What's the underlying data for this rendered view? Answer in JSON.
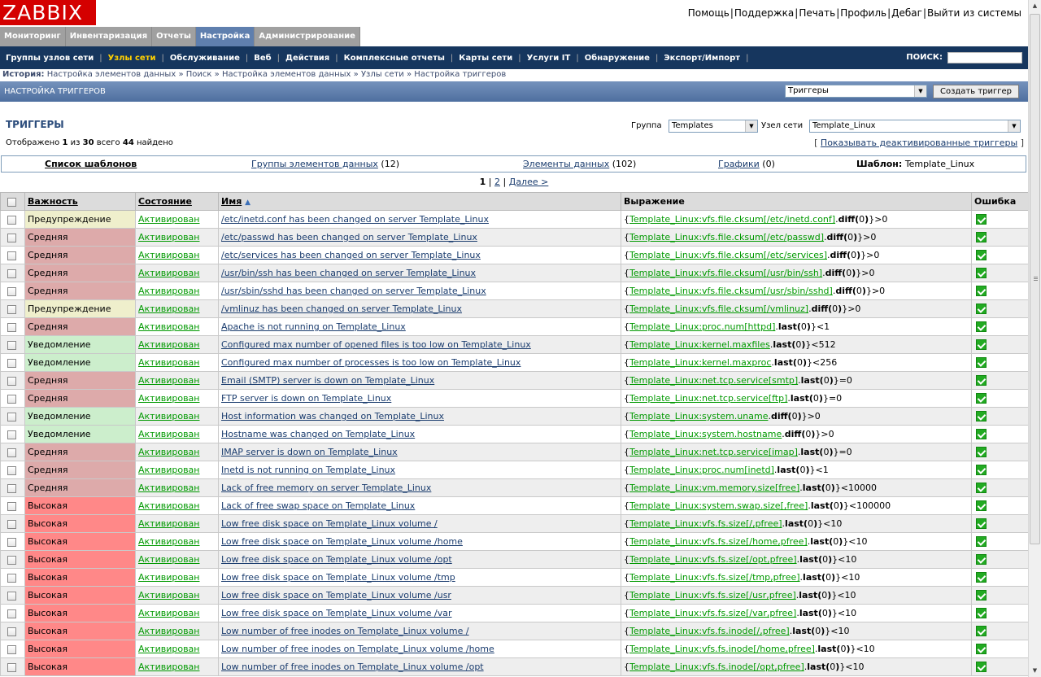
{
  "header": {
    "logo": "ZABBIX",
    "links": [
      "Помощь",
      "Поддержка",
      "Печать",
      "Профиль",
      "Дебаг",
      "Выйти из системы"
    ]
  },
  "main_menu": [
    "Мониторинг",
    "Инвентаризация",
    "Отчеты",
    "Настройка",
    "Администрирование"
  ],
  "main_menu_active": "Настройка",
  "sub_menu": [
    "Группы узлов сети",
    "Узлы сети",
    "Обслуживание",
    "Веб",
    "Действия",
    "Комплексные отчеты",
    "Карты сети",
    "Услуги IT",
    "Обнаружение",
    "Экспорт/Импорт"
  ],
  "sub_menu_active": "Узлы сети",
  "search_label": "ПОИСК:",
  "breadcrumb": {
    "label": "История:",
    "items": [
      "Настройка элементов данных",
      "Поиск",
      "Настройка элементов данных",
      "Узлы сети",
      "Настройка триггеров"
    ],
    "separator": "»"
  },
  "titlebar": {
    "title": "НАСТРОЙКА ТРИГГЕРОВ",
    "select_value": "Триггеры",
    "create_button": "Создать триггер"
  },
  "filter": {
    "title": "ТРИГГЕРЫ",
    "count_prefix": "Отображено",
    "count_from": "1",
    "count_of_label": "из",
    "count_to": "30",
    "count_total_label": "всего",
    "count_total": "44",
    "count_found_label": "найдено",
    "group_label": "Группа",
    "group_value": "Templates",
    "host_label": "Узел сети",
    "host_value": "Template_Linux",
    "show_disabled": "Показывать деактивированные триггеры"
  },
  "tabs": {
    "template_list": "Список шаблонов",
    "applications": "Группы элементов данных",
    "applications_count": "(12)",
    "items": "Элементы данных",
    "items_count": "(102)",
    "graphs": "Графики",
    "graphs_count": "(0)",
    "template_label": "Шаблон:",
    "template_value": "Template_Linux"
  },
  "pager": {
    "current": "1",
    "other": "2",
    "next": "Далее >"
  },
  "table": {
    "headers": {
      "severity": "Важность",
      "status": "Состояние",
      "name": "Имя",
      "expression": "Выражение",
      "error": "Ошибка"
    },
    "rows": [
      {
        "sev": "Предупреждение",
        "sevclass": "warn",
        "status": "Активирован",
        "name": "/etc/inetd.conf has been changed on server Template_Linux",
        "pre": "{",
        "key": "Template_Linux:vfs.file.cksum[/etc/inetd.conf]",
        "fn": "diff",
        "arg": "0",
        "post": "}>0"
      },
      {
        "sev": "Средняя",
        "sevclass": "avg",
        "status": "Активирован",
        "name": "/etc/passwd has been changed on server Template_Linux",
        "pre": "{",
        "key": "Template_Linux:vfs.file.cksum[/etc/passwd]",
        "fn": "diff",
        "arg": "0",
        "post": "}>0"
      },
      {
        "sev": "Средняя",
        "sevclass": "avg",
        "status": "Активирован",
        "name": "/etc/services has been changed on server Template_Linux",
        "pre": "{",
        "key": "Template_Linux:vfs.file.cksum[/etc/services]",
        "fn": "diff",
        "arg": "0",
        "post": "}>0"
      },
      {
        "sev": "Средняя",
        "sevclass": "avg",
        "status": "Активирован",
        "name": "/usr/bin/ssh has been changed on server Template_Linux",
        "pre": "{",
        "key": "Template_Linux:vfs.file.cksum[/usr/bin/ssh]",
        "fn": "diff",
        "arg": "0",
        "post": "}>0"
      },
      {
        "sev": "Средняя",
        "sevclass": "avg",
        "status": "Активирован",
        "name": "/usr/sbin/sshd has been changed on server Template_Linux",
        "pre": "{",
        "key": "Template_Linux:vfs.file.cksum[/usr/sbin/sshd]",
        "fn": "diff",
        "arg": "0",
        "post": "}>0"
      },
      {
        "sev": "Предупреждение",
        "sevclass": "warn",
        "status": "Активирован",
        "name": "/vmlinuz has been changed on server Template_Linux",
        "pre": "{",
        "key": "Template_Linux:vfs.file.cksum[/vmlinuz]",
        "fn": "diff",
        "arg": "0",
        "post": "}>0"
      },
      {
        "sev": "Средняя",
        "sevclass": "avg",
        "status": "Активирован",
        "name": "Apache is not running on Template_Linux",
        "pre": "{",
        "key": "Template_Linux:proc.num[httpd]",
        "fn": "last",
        "arg": "0",
        "post": "}<1"
      },
      {
        "sev": "Уведомление",
        "sevclass": "info",
        "status": "Активирован",
        "name": "Configured max number of opened files is too low on Template_Linux",
        "pre": "{",
        "key": "Template_Linux:kernel.maxfiles",
        "fn": "last",
        "arg": "0",
        "post": "}<512"
      },
      {
        "sev": "Уведомление",
        "sevclass": "info",
        "status": "Активирован",
        "name": "Configured max number of processes is too low on Template_Linux",
        "pre": "{",
        "key": "Template_Linux:kernel.maxproc",
        "fn": "last",
        "arg": "0",
        "post": "}<256"
      },
      {
        "sev": "Средняя",
        "sevclass": "avg",
        "status": "Активирован",
        "name": "Email (SMTP) server is down on Template_Linux",
        "pre": "{",
        "key": "Template_Linux:net.tcp.service[smtp]",
        "fn": "last",
        "arg": "0",
        "post": "}=0"
      },
      {
        "sev": "Средняя",
        "sevclass": "avg",
        "status": "Активирован",
        "name": "FTP server is down on Template_Linux",
        "pre": "{",
        "key": "Template_Linux:net.tcp.service[ftp]",
        "fn": "last",
        "arg": "0",
        "post": "}=0"
      },
      {
        "sev": "Уведомление",
        "sevclass": "info",
        "status": "Активирован",
        "name": "Host information was changed on Template_Linux",
        "pre": "{",
        "key": "Template_Linux:system.uname",
        "fn": "diff",
        "arg": "0",
        "post": "}>0"
      },
      {
        "sev": "Уведомление",
        "sevclass": "info",
        "status": "Активирован",
        "name": "Hostname was changed on Template_Linux",
        "pre": "{",
        "key": "Template_Linux:system.hostname",
        "fn": "diff",
        "arg": "0",
        "post": "}>0"
      },
      {
        "sev": "Средняя",
        "sevclass": "avg",
        "status": "Активирован",
        "name": "IMAP server is down on Template_Linux",
        "pre": "{",
        "key": "Template_Linux:net.tcp.service[imap]",
        "fn": "last",
        "arg": "0",
        "post": "}=0"
      },
      {
        "sev": "Средняя",
        "sevclass": "avg",
        "status": "Активирован",
        "name": "Inetd is not running on Template_Linux",
        "pre": "{",
        "key": "Template_Linux:proc.num[inetd]",
        "fn": "last",
        "arg": "0",
        "post": "}<1"
      },
      {
        "sev": "Средняя",
        "sevclass": "avg",
        "status": "Активирован",
        "name": "Lack of free memory on server Template_Linux",
        "pre": "{",
        "key": "Template_Linux:vm.memory.size[free]",
        "fn": "last",
        "arg": "0",
        "post": "}<10000"
      },
      {
        "sev": "Высокая",
        "sevclass": "high",
        "status": "Активирован",
        "name": "Lack of free swap space on Template_Linux",
        "pre": "{",
        "key": "Template_Linux:system.swap.size[,free]",
        "fn": "last",
        "arg": "0",
        "post": "}<100000"
      },
      {
        "sev": "Высокая",
        "sevclass": "high",
        "status": "Активирован",
        "name": "Low free disk space on Template_Linux volume /",
        "pre": "{",
        "key": "Template_Linux:vfs.fs.size[/,pfree]",
        "fn": "last",
        "arg": "0",
        "post": "}<10"
      },
      {
        "sev": "Высокая",
        "sevclass": "high",
        "status": "Активирован",
        "name": "Low free disk space on Template_Linux volume /home",
        "pre": "{",
        "key": "Template_Linux:vfs.fs.size[/home,pfree]",
        "fn": "last",
        "arg": "0",
        "post": "}<10"
      },
      {
        "sev": "Высокая",
        "sevclass": "high",
        "status": "Активирован",
        "name": "Low free disk space on Template_Linux volume /opt",
        "pre": "{",
        "key": "Template_Linux:vfs.fs.size[/opt,pfree]",
        "fn": "last",
        "arg": "0",
        "post": "}<10"
      },
      {
        "sev": "Высокая",
        "sevclass": "high",
        "status": "Активирован",
        "name": "Low free disk space on Template_Linux volume /tmp",
        "pre": "{",
        "key": "Template_Linux:vfs.fs.size[/tmp,pfree]",
        "fn": "last",
        "arg": "0",
        "post": "}<10"
      },
      {
        "sev": "Высокая",
        "sevclass": "high",
        "status": "Активирован",
        "name": "Low free disk space on Template_Linux volume /usr",
        "pre": "{",
        "key": "Template_Linux:vfs.fs.size[/usr,pfree]",
        "fn": "last",
        "arg": "0",
        "post": "}<10"
      },
      {
        "sev": "Высокая",
        "sevclass": "high",
        "status": "Активирован",
        "name": "Low free disk space on Template_Linux volume /var",
        "pre": "{",
        "key": "Template_Linux:vfs.fs.size[/var,pfree]",
        "fn": "last",
        "arg": "0",
        "post": "}<10"
      },
      {
        "sev": "Высокая",
        "sevclass": "high",
        "status": "Активирован",
        "name": "Low number of free inodes on Template_Linux volume /",
        "pre": "{",
        "key": "Template_Linux:vfs.fs.inode[/,pfree]",
        "fn": "last",
        "arg": "0",
        "post": "}<10"
      },
      {
        "sev": "Высокая",
        "sevclass": "high",
        "status": "Активирован",
        "name": "Low number of free inodes on Template_Linux volume /home",
        "pre": "{",
        "key": "Template_Linux:vfs.fs.inode[/home,pfree]",
        "fn": "last",
        "arg": "0",
        "post": "}<10"
      },
      {
        "sev": "Высокая",
        "sevclass": "high",
        "status": "Активирован",
        "name": "Low number of free inodes on Template_Linux volume /opt",
        "pre": "{",
        "key": "Template_Linux:vfs.fs.inode[/opt,pfree]",
        "fn": "last",
        "arg": "0",
        "post": "}<10"
      }
    ]
  },
  "colors": {
    "logo_bg": "#d40000",
    "nav_bg": "#16365e",
    "nav_active": "#ffd000",
    "sev_warning": "#efefcc",
    "sev_average": "#ddaaaa",
    "sev_info": "#cceecc",
    "sev_high": "#ff8888",
    "status_enabled": "#009900"
  }
}
